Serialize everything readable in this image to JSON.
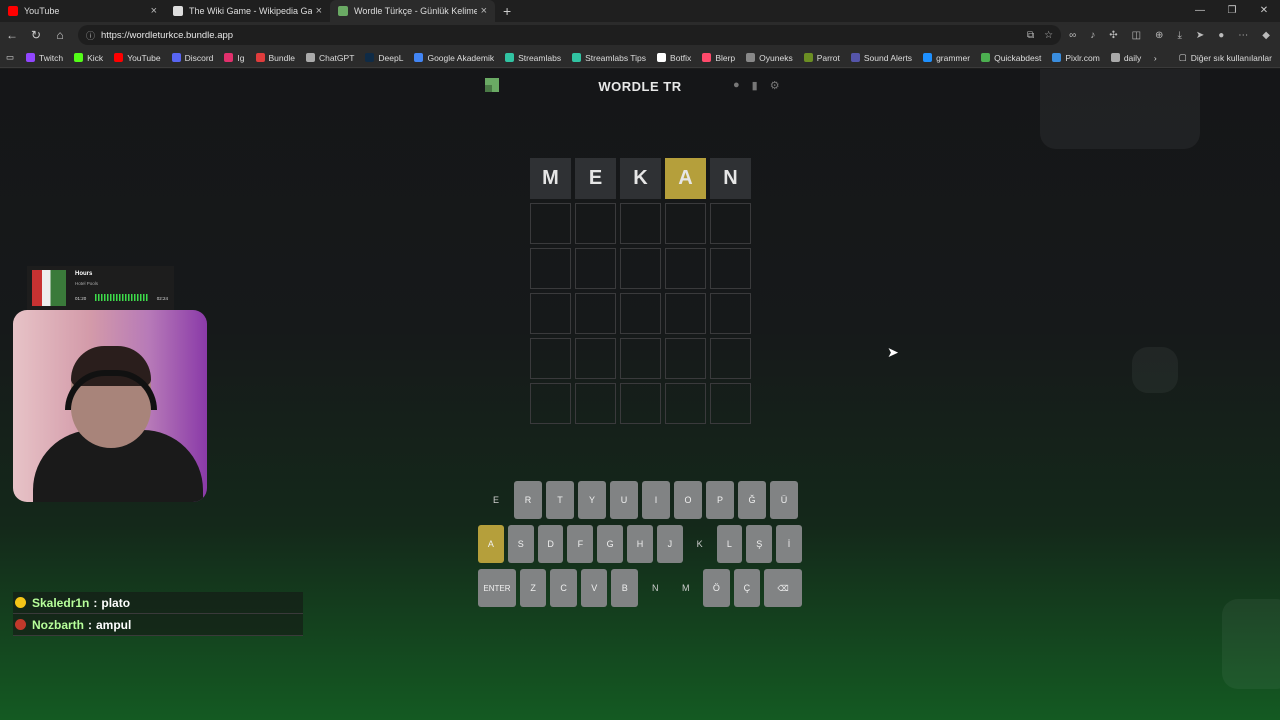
{
  "browser": {
    "tabs": [
      {
        "title": "YouTube",
        "favicon_color": "#ff0000",
        "active": false
      },
      {
        "title": "The Wiki Game - Wikipedia Game",
        "favicon_color": "#dddddd",
        "active": false
      },
      {
        "title": "Wordle Türkçe - Günlük Kelime O",
        "favicon_color": "#6aaa64",
        "active": true
      }
    ],
    "url": "https://wordleturkce.bundle.app",
    "bookmarks": [
      {
        "label": "Twitch",
        "color": "#9146ff"
      },
      {
        "label": "Kick",
        "color": "#53fc18"
      },
      {
        "label": "YouTube",
        "color": "#ff0000"
      },
      {
        "label": "Discord",
        "color": "#5865f2"
      },
      {
        "label": "Ig",
        "color": "#e1306c"
      },
      {
        "label": "Bundle",
        "color": "#e03c3c"
      },
      {
        "label": "ChatGPT",
        "color": "#aaaaaa"
      },
      {
        "label": "DeepL",
        "color": "#0f2b46"
      },
      {
        "label": "Google Akademik",
        "color": "#4285f4"
      },
      {
        "label": "Streamlabs",
        "color": "#31c3a2"
      },
      {
        "label": "Streamlabs Tips",
        "color": "#31c3a2"
      },
      {
        "label": "Botfix",
        "color": "#ffffff"
      },
      {
        "label": "Blerp",
        "color": "#ff4a6b"
      },
      {
        "label": "Oyuneks",
        "color": "#888888"
      },
      {
        "label": "Parrot",
        "color": "#6b8e23"
      },
      {
        "label": "Sound Alerts",
        "color": "#5555aa"
      },
      {
        "label": "grammer",
        "color": "#1e90ff"
      },
      {
        "label": "Quickabdest",
        "color": "#4caf50"
      },
      {
        "label": "Pixlr.com",
        "color": "#3a8dde"
      },
      {
        "label": "daily",
        "color": "#aaaaaa"
      }
    ],
    "other_bookmarks": "Diğer sık kullanılanlar"
  },
  "game": {
    "title": "WORDLE TR",
    "board": [
      [
        {
          "l": "M",
          "s": "absent"
        },
        {
          "l": "E",
          "s": "absent"
        },
        {
          "l": "K",
          "s": "absent"
        },
        {
          "l": "A",
          "s": "present"
        },
        {
          "l": "N",
          "s": "absent"
        }
      ],
      [
        {
          "l": "",
          "s": "empty"
        },
        {
          "l": "",
          "s": "empty"
        },
        {
          "l": "",
          "s": "empty"
        },
        {
          "l": "",
          "s": "empty"
        },
        {
          "l": "",
          "s": "empty"
        }
      ],
      [
        {
          "l": "",
          "s": "empty"
        },
        {
          "l": "",
          "s": "empty"
        },
        {
          "l": "",
          "s": "empty"
        },
        {
          "l": "",
          "s": "empty"
        },
        {
          "l": "",
          "s": "empty"
        }
      ],
      [
        {
          "l": "",
          "s": "empty"
        },
        {
          "l": "",
          "s": "empty"
        },
        {
          "l": "",
          "s": "empty"
        },
        {
          "l": "",
          "s": "empty"
        },
        {
          "l": "",
          "s": "empty"
        }
      ],
      [
        {
          "l": "",
          "s": "empty"
        },
        {
          "l": "",
          "s": "empty"
        },
        {
          "l": "",
          "s": "empty"
        },
        {
          "l": "",
          "s": "empty"
        },
        {
          "l": "",
          "s": "empty"
        }
      ],
      [
        {
          "l": "",
          "s": "empty"
        },
        {
          "l": "",
          "s": "empty"
        },
        {
          "l": "",
          "s": "empty"
        },
        {
          "l": "",
          "s": "empty"
        },
        {
          "l": "",
          "s": "empty"
        }
      ]
    ],
    "keyboard": [
      [
        {
          "k": "E",
          "s": "absent"
        },
        {
          "k": "R"
        },
        {
          "k": "T"
        },
        {
          "k": "Y"
        },
        {
          "k": "U"
        },
        {
          "k": "I"
        },
        {
          "k": "O"
        },
        {
          "k": "P"
        },
        {
          "k": "Ğ"
        },
        {
          "k": "Ü"
        }
      ],
      [
        {
          "k": "A",
          "s": "present"
        },
        {
          "k": "S"
        },
        {
          "k": "D"
        },
        {
          "k": "F"
        },
        {
          "k": "G"
        },
        {
          "k": "H"
        },
        {
          "k": "J"
        },
        {
          "k": "K",
          "s": "absent"
        },
        {
          "k": "L"
        },
        {
          "k": "Ş"
        },
        {
          "k": "İ"
        }
      ],
      [
        {
          "k": "ENTER",
          "wide": true
        },
        {
          "k": "Z"
        },
        {
          "k": "C"
        },
        {
          "k": "V"
        },
        {
          "k": "B"
        },
        {
          "k": "N",
          "s": "absent"
        },
        {
          "k": "M",
          "s": "absent"
        },
        {
          "k": "Ö"
        },
        {
          "k": "Ç"
        },
        {
          "k": "⌫",
          "wide": true
        }
      ]
    ]
  },
  "overlay": {
    "music": {
      "song": "Hours",
      "artist": "Hotel Pools",
      "elapsed": "01:20",
      "duration": "02:24",
      "progress": 0.55
    },
    "chat": [
      {
        "user": "Skaledr1n",
        "message": "plato",
        "badge_color": "#f5c518"
      },
      {
        "user": "Nozbarth",
        "message": "ampul",
        "badge_color": "#c0392b"
      }
    ]
  }
}
